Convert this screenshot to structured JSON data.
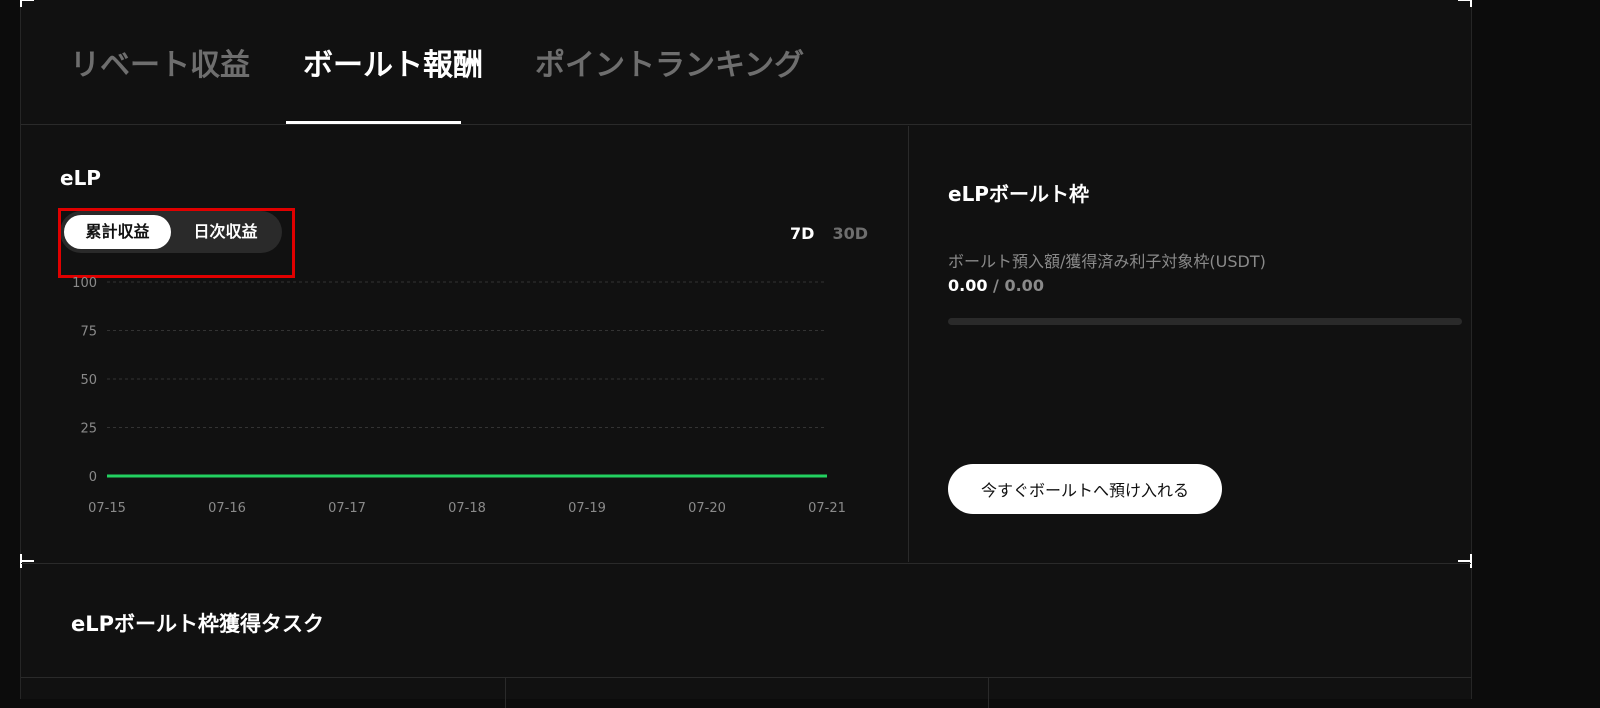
{
  "tabs": [
    {
      "label": "リベート収益",
      "active": false
    },
    {
      "label": "ボールト報酬",
      "active": true
    },
    {
      "label": "ポイントランキング",
      "active": false
    }
  ],
  "earnings_panel": {
    "title": "eLP",
    "toggle": {
      "cumulative": "累計収益",
      "daily": "日次収益",
      "selected": "cumulative"
    },
    "ranges": {
      "d7": "7D",
      "d30": "30D",
      "selected": "7D"
    }
  },
  "chart_data": {
    "type": "line",
    "x": [
      "07-15",
      "07-16",
      "07-17",
      "07-18",
      "07-19",
      "07-20",
      "07-21"
    ],
    "series": [
      {
        "values": [
          0,
          0,
          0,
          0,
          0,
          0,
          0
        ],
        "color": "#22d160"
      }
    ],
    "yticks": [
      100,
      75,
      50,
      25,
      0
    ],
    "ylim": [
      0,
      100
    ],
    "grid": true
  },
  "vault": {
    "title": "eLPボールト枠",
    "label": "ボールト預入額/獲得済み利子対象枠(USDT)",
    "deposited": "0.00",
    "separator": " / ",
    "limit": "0.00",
    "progress": 0,
    "deposit_button": "今すぐボールトへ預け入れる"
  },
  "tasks": {
    "title": "eLPボールト枠獲得タスク"
  },
  "colors": {
    "accent": "#22d160",
    "background": "#111111",
    "highlight": "#e00000"
  }
}
